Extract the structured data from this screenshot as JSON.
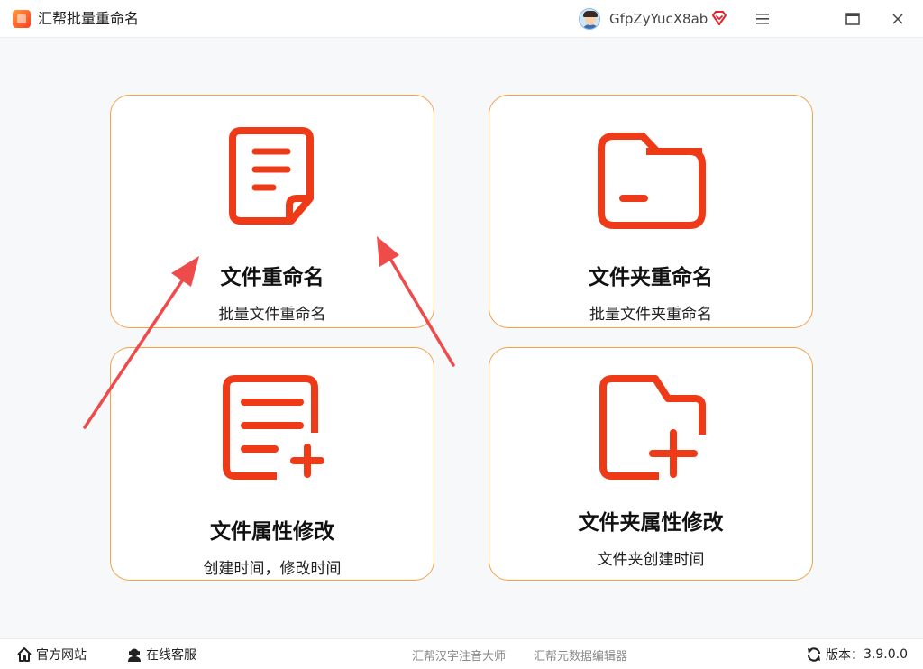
{
  "window": {
    "title": "汇帮批量重命名",
    "username": "GfpZyYucX8ab",
    "icons": {
      "menu": "hamburger-menu-icon",
      "maximize": "maximize-icon",
      "close": "close-icon",
      "vip": "diamond-vip-icon"
    }
  },
  "cards": [
    {
      "title": "文件重命名",
      "subtitle": "批量文件重命名",
      "icon": "file-document-icon"
    },
    {
      "title": "文件夹重命名",
      "subtitle": "批量文件夹重命名",
      "icon": "folder-icon"
    },
    {
      "title": "文件属性修改",
      "subtitle": "创建时间，修改时间",
      "icon": "file-list-add-icon"
    },
    {
      "title": "文件夹属性修改",
      "subtitle": "文件夹创建时间",
      "icon": "folder-add-icon"
    }
  ],
  "footer": {
    "website": "官方网站",
    "support": "在线客服",
    "link1": "汇帮汉字注音大师",
    "link2": "汇帮元数据编辑器",
    "version_label": "版本：",
    "version": "3.9.0.0"
  },
  "colors": {
    "accent": "#ee3a17",
    "card_border": "#f2a246",
    "arrow": "#ee4b4b"
  }
}
